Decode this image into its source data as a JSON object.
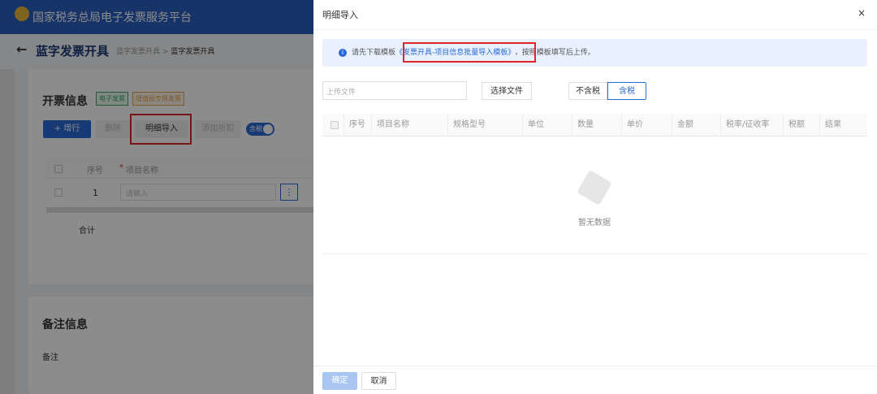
{
  "header": {
    "title": "国家税务总局电子发票服务平台"
  },
  "page": {
    "back_icon": "arrow-left-icon",
    "title": "蓝字发票开具",
    "breadcrumb": [
      "蓝字发票开具",
      "蓝字发票开具"
    ],
    "breadcrumb_sep": ">"
  },
  "invoice_card": {
    "title": "开票信息",
    "tags": [
      "电子发票",
      "增值税专用发票"
    ],
    "buttons": {
      "add_row": "+ 增行",
      "delete": "删除",
      "detail_import": "明细导入",
      "add_discount": "添加折扣",
      "tax_toggle": "含税"
    },
    "table": {
      "headers": [
        "序号",
        "项目名称"
      ],
      "required_mark": "*",
      "rows": [
        {
          "index": "1",
          "name_placeholder": "请输入"
        }
      ],
      "total_label": "合计"
    }
  },
  "remark_card": {
    "title": "备注信息",
    "label": "备注"
  },
  "drawer": {
    "title": "明细导入",
    "close": "×",
    "alert": {
      "prefix": "请先下载模板",
      "link": "《发票开具-项目信息批量导入模板》",
      "suffix": "，按照模板填写后上传。"
    },
    "upload_placeholder": "上传文件",
    "choose_file": "选择文件",
    "tax_options": [
      "不含税",
      "含税"
    ],
    "tax_selected": "含税",
    "table_headers": [
      "序号",
      "项目名称",
      "规格型号",
      "单位",
      "数量",
      "单价",
      "金额",
      "税率/征收率",
      "税额",
      "结果"
    ],
    "empty_text": "暂无数据",
    "confirm": "确定",
    "cancel": "取消"
  },
  "colors": {
    "primary": "#2a6ad8",
    "alert_bg": "#e8f1fd",
    "highlight": "#e0262c"
  }
}
